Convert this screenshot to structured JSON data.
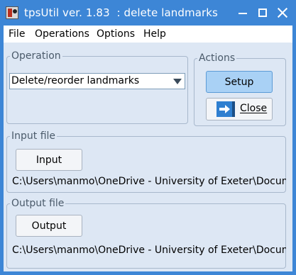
{
  "window": {
    "title": "tpsUtil ver. 1.83  : delete landmarks"
  },
  "menu": {
    "items": [
      "File",
      "Operations",
      "Options",
      "Help"
    ]
  },
  "operation": {
    "legend": "Operation",
    "selected": "Delete/reorder landmarks"
  },
  "actions": {
    "legend": "Actions",
    "setup_label": "Setup",
    "close_label": "Close"
  },
  "input_file": {
    "legend": "Input file",
    "button_label": "Input",
    "path": "C:\\Users\\manmo\\OneDrive - University of Exeter\\Document"
  },
  "output_file": {
    "legend": "Output file",
    "button_label": "Output",
    "path": "C:\\Users\\manmo\\OneDrive - University of Exeter\\Document"
  },
  "colors": {
    "titlebar": "#3d86d6",
    "client_bg": "#dde7f4",
    "setup_button": "#a9d1f5"
  },
  "icons": {
    "app": "app-icon",
    "close_door": "exit-door-icon"
  }
}
